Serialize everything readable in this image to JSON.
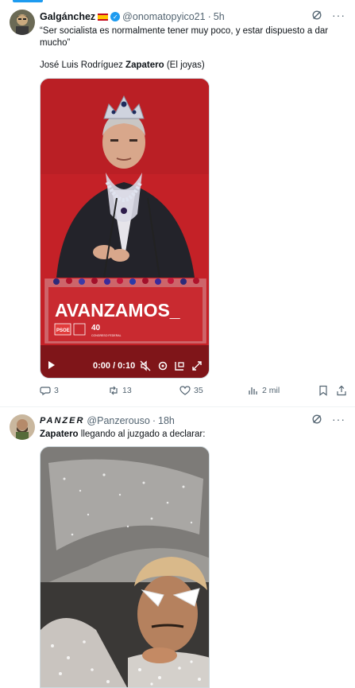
{
  "tweets": [
    {
      "author": "Galgánchez",
      "handle": "@onomatopyico21",
      "separator": "·",
      "time": "5h",
      "text_line1": "“Ser socialista es normalmente tener muy poco, y estar dispuesto a dar mucho”",
      "text_line2_prefix": "José Luis Rodríguez ",
      "text_line2_bold": "Zapatero",
      "text_line2_suffix": " (El joyas)",
      "video": {
        "time": "0:00 / 0:10",
        "sign_text": "AVANZAMOS_",
        "logo_text": "PSOE",
        "badge_number": "40",
        "badge_text": "CONGRESO FEDERAL"
      },
      "actions": {
        "replies": "3",
        "reposts": "13",
        "likes": "35",
        "views": "2 mil"
      }
    },
    {
      "author": "PANZER",
      "handle": "@Panzerouso",
      "separator": "·",
      "time": "18h",
      "text_bold": "Zapatero",
      "text_rest": " llegando al juzgado a declarar:"
    }
  ],
  "colors": {
    "accent": "#1d9bf0",
    "text": "#0f1419",
    "secondary": "#536471",
    "border": "#eff3f4"
  },
  "icons": [
    "grok-icon",
    "more-icon",
    "play-icon",
    "mute-icon",
    "settings-icon",
    "pip-icon",
    "fullscreen-icon",
    "reply-icon",
    "repost-icon",
    "like-icon",
    "views-icon",
    "bookmark-icon",
    "share-icon",
    "verified-icon"
  ]
}
